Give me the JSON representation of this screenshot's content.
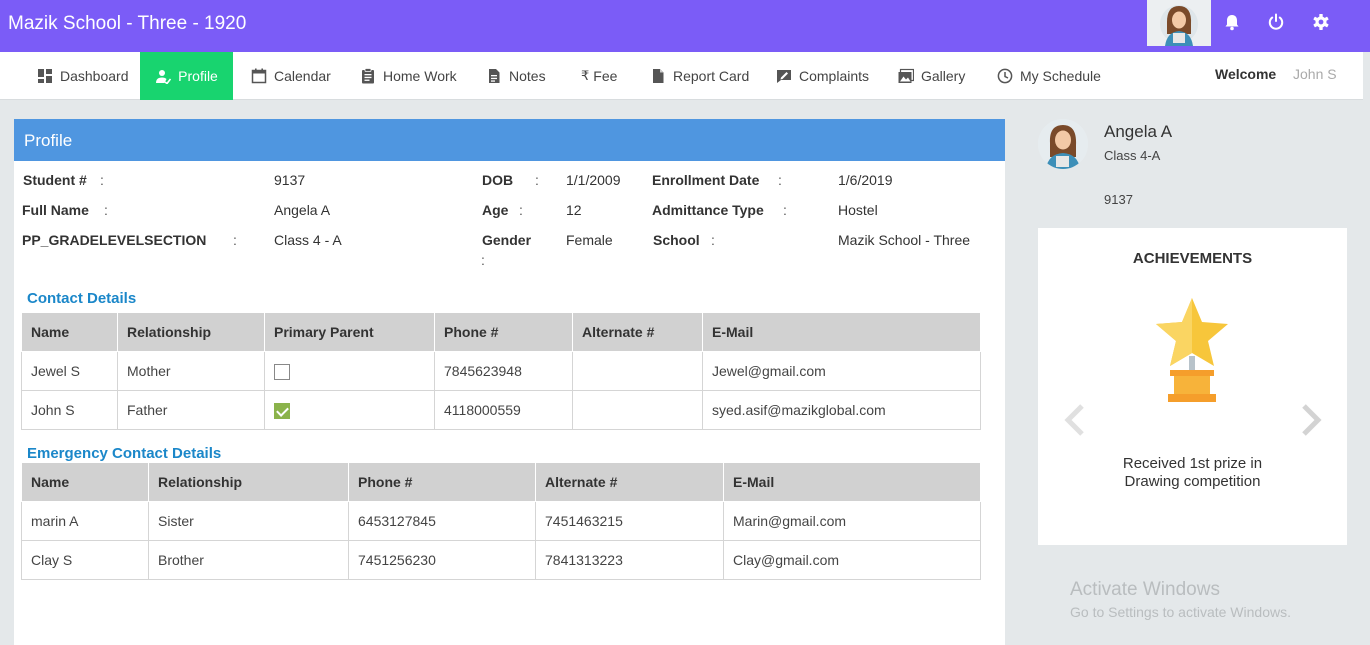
{
  "app": {
    "title": "Mazik School - Three  -  1920"
  },
  "topbar": {
    "icons": [
      "avatar",
      "bell-icon",
      "power-icon",
      "gear-icon"
    ]
  },
  "nav": {
    "items": [
      {
        "label": "Dashboard",
        "icon": "dashboard-icon"
      },
      {
        "label": "Profile",
        "icon": "user-icon",
        "active": true
      },
      {
        "label": "Calendar",
        "icon": "calendar-icon"
      },
      {
        "label": "Home Work",
        "icon": "clipboard-icon"
      },
      {
        "label": "Notes",
        "icon": "document-icon"
      },
      {
        "label": "Fee",
        "icon": "rupee-icon",
        "glyph": "₹"
      },
      {
        "label": "Report Card",
        "icon": "file-icon"
      },
      {
        "label": "Complaints",
        "icon": "complaint-icon"
      },
      {
        "label": "Gallery",
        "icon": "gallery-icon"
      },
      {
        "label": "My Schedule",
        "icon": "clock-icon"
      }
    ],
    "welcome_label": "Welcome",
    "welcome_name": "John S"
  },
  "profile": {
    "header": "Profile",
    "fields": {
      "student_no": {
        "label": "Student #",
        "value": "9137"
      },
      "full_name": {
        "label": "Full Name",
        "value": "Angela A"
      },
      "grade_section": {
        "label": "PP_GRADELEVELSECTION",
        "value": "Class 4 - A"
      },
      "dob": {
        "label": "DOB",
        "value": "1/1/2009"
      },
      "age": {
        "label": "Age",
        "value": "12"
      },
      "gender": {
        "label": "Gender",
        "value": "Female"
      },
      "enrollment_date": {
        "label": "Enrollment Date",
        "value": "1/6/2019"
      },
      "admittance_type": {
        "label": "Admittance Type",
        "value": "Hostel"
      },
      "school": {
        "label": "School",
        "value": "Mazik School - Three"
      }
    },
    "colon": ":"
  },
  "contact": {
    "title": "Contact Details",
    "headers": [
      "Name",
      "Relationship",
      "Primary Parent",
      "Phone #",
      "Alternate #",
      "E-Mail"
    ],
    "rows": [
      {
        "name": "Jewel S",
        "relationship": "Mother",
        "primary": false,
        "phone": "7845623948",
        "alternate": "",
        "email": "Jewel@gmail.com"
      },
      {
        "name": "John S",
        "relationship": "Father",
        "primary": true,
        "phone": "4118000559",
        "alternate": "",
        "email": "syed.asif@mazikglobal.com"
      }
    ]
  },
  "emergency": {
    "title": "Emergency Contact Details",
    "headers": [
      "Name",
      "Relationship",
      "Phone #",
      "Alternate #",
      "E-Mail"
    ],
    "rows": [
      {
        "name": "marin A",
        "relationship": "Sister",
        "phone": "6453127845",
        "alternate": "7451463215",
        "email": "Marin@gmail.com"
      },
      {
        "name": "Clay S",
        "relationship": "Brother",
        "phone": "7451256230",
        "alternate": "7841313223",
        "email": "Clay@gmail.com"
      }
    ]
  },
  "sidebar": {
    "name": "Angela A",
    "class": "Class 4-A",
    "student_id": "9137",
    "achievements": {
      "title": "ACHIEVEMENTS",
      "text": "Received 1st prize in Drawing competition"
    }
  },
  "watermark": {
    "line1": "Activate Windows",
    "line2": "Go to Settings to activate Windows."
  },
  "colors": {
    "topbar": "#7b5cf7",
    "nav_active": "#18d46f",
    "panel_header": "#4f96e0",
    "section_title": "#1b87c9"
  }
}
